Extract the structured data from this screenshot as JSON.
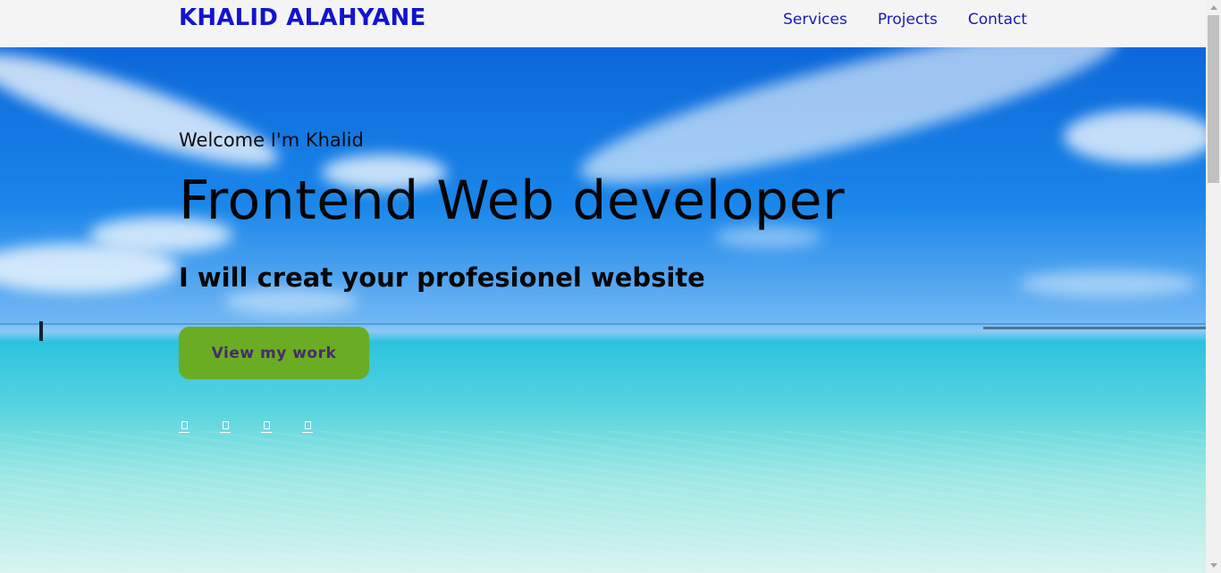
{
  "header": {
    "logo": "KHALID ALAHYANE",
    "nav": [
      {
        "label": "Services"
      },
      {
        "label": "Projects"
      },
      {
        "label": "Contact"
      }
    ]
  },
  "hero": {
    "welcome": "Welcome I'm Khalid",
    "title": "Frontend Web developer",
    "subtitle": "I will creat your profesionel website",
    "cta_label": "View my work",
    "socials": [
      {
        "icon": "social-icon-1"
      },
      {
        "icon": "social-icon-2"
      },
      {
        "icon": "social-icon-3"
      },
      {
        "icon": "social-icon-4"
      }
    ]
  },
  "colors": {
    "logo": "#1313cf",
    "nav": "#1a1ab8",
    "cta_bg": "#6aac24",
    "cta_text": "#4a2a6a"
  }
}
